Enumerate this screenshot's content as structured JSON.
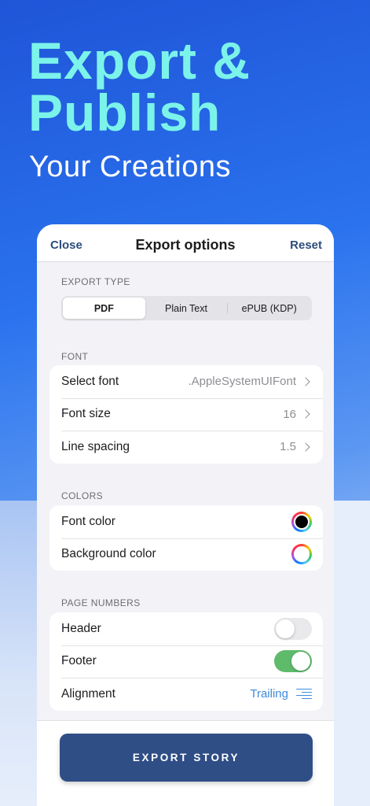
{
  "promo": {
    "headline_line1": "Export &",
    "headline_line2": "Publish",
    "subheadline": "Your Creations"
  },
  "nav": {
    "close_label": "Close",
    "title": "Export options",
    "reset_label": "Reset"
  },
  "export_type": {
    "section_label": "EXPORT TYPE",
    "options": [
      "PDF",
      "Plain Text",
      "ePUB (KDP)"
    ],
    "selected": "PDF"
  },
  "font": {
    "section_label": "FONT",
    "rows": [
      {
        "label": "Select font",
        "value": ".AppleSystemUIFont"
      },
      {
        "label": "Font size",
        "value": "16"
      },
      {
        "label": "Line spacing",
        "value": "1.5"
      }
    ]
  },
  "colors": {
    "section_label": "COLORS",
    "font_color_label": "Font color",
    "font_color_value": "#000000",
    "background_color_label": "Background color",
    "background_color_value": "#ffffff"
  },
  "page_numbers": {
    "section_label": "PAGE NUMBERS",
    "header_label": "Header",
    "header_enabled": false,
    "footer_label": "Footer",
    "footer_enabled": true,
    "alignment_label": "Alignment",
    "alignment_value": "Trailing"
  },
  "footer": {
    "export_button_label": "EXPORT STORY"
  },
  "colors_theme": {
    "headline": "#7cf3ea",
    "nav_accent": "#2c4c7a",
    "toggle_on": "#5dbb6b",
    "link_blue": "#3d8bdc",
    "export_button": "#2f4e86"
  }
}
